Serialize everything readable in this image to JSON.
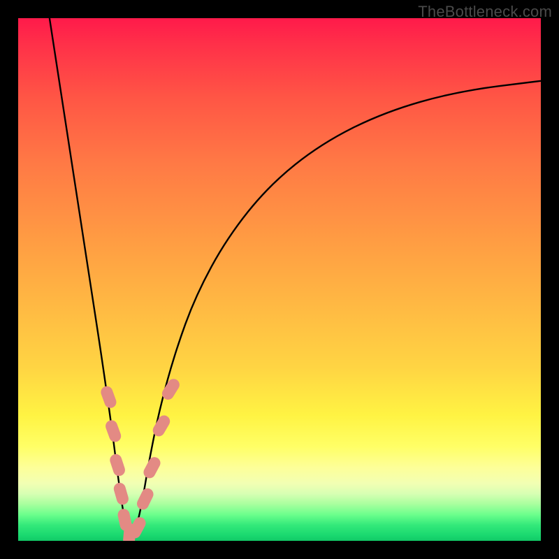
{
  "watermark": "TheBottleneck.com",
  "chart_data": {
    "type": "line",
    "title": "",
    "xlabel": "",
    "ylabel": "",
    "xlim": [
      0,
      100
    ],
    "ylim": [
      0,
      100
    ],
    "series": [
      {
        "name": "bottleneck-curve",
        "x": [
          6,
          8,
          10,
          12,
          14,
          16,
          18,
          19,
          20,
          21,
          22,
          23,
          24,
          25,
          27,
          30,
          34,
          40,
          48,
          58,
          70,
          84,
          100
        ],
        "y": [
          100,
          87,
          74,
          61,
          48,
          35,
          21,
          13,
          6,
          1,
          1,
          4,
          9,
          15,
          25,
          36,
          47,
          58,
          68,
          76,
          82,
          86,
          88
        ]
      }
    ],
    "markers": {
      "name": "capsule-markers",
      "color": "#e38a84",
      "points": [
        {
          "x": 17.3,
          "y": 27.5,
          "angle": 70
        },
        {
          "x": 18.2,
          "y": 21.0,
          "angle": 70
        },
        {
          "x": 19.0,
          "y": 14.5,
          "angle": 72
        },
        {
          "x": 19.7,
          "y": 9.0,
          "angle": 74
        },
        {
          "x": 20.4,
          "y": 4.0,
          "angle": 78
        },
        {
          "x": 21.3,
          "y": 1.2,
          "angle": 95
        },
        {
          "x": 22.8,
          "y": 2.5,
          "angle": 118
        },
        {
          "x": 24.3,
          "y": 8.0,
          "angle": 116
        },
        {
          "x": 25.6,
          "y": 14.0,
          "angle": 118
        },
        {
          "x": 27.4,
          "y": 22.0,
          "angle": 120
        },
        {
          "x": 29.2,
          "y": 29.0,
          "angle": 122
        }
      ]
    },
    "background_gradient": {
      "top": "#ff1a4a",
      "mid": "#ffd543",
      "bottom": "#12c866"
    }
  }
}
